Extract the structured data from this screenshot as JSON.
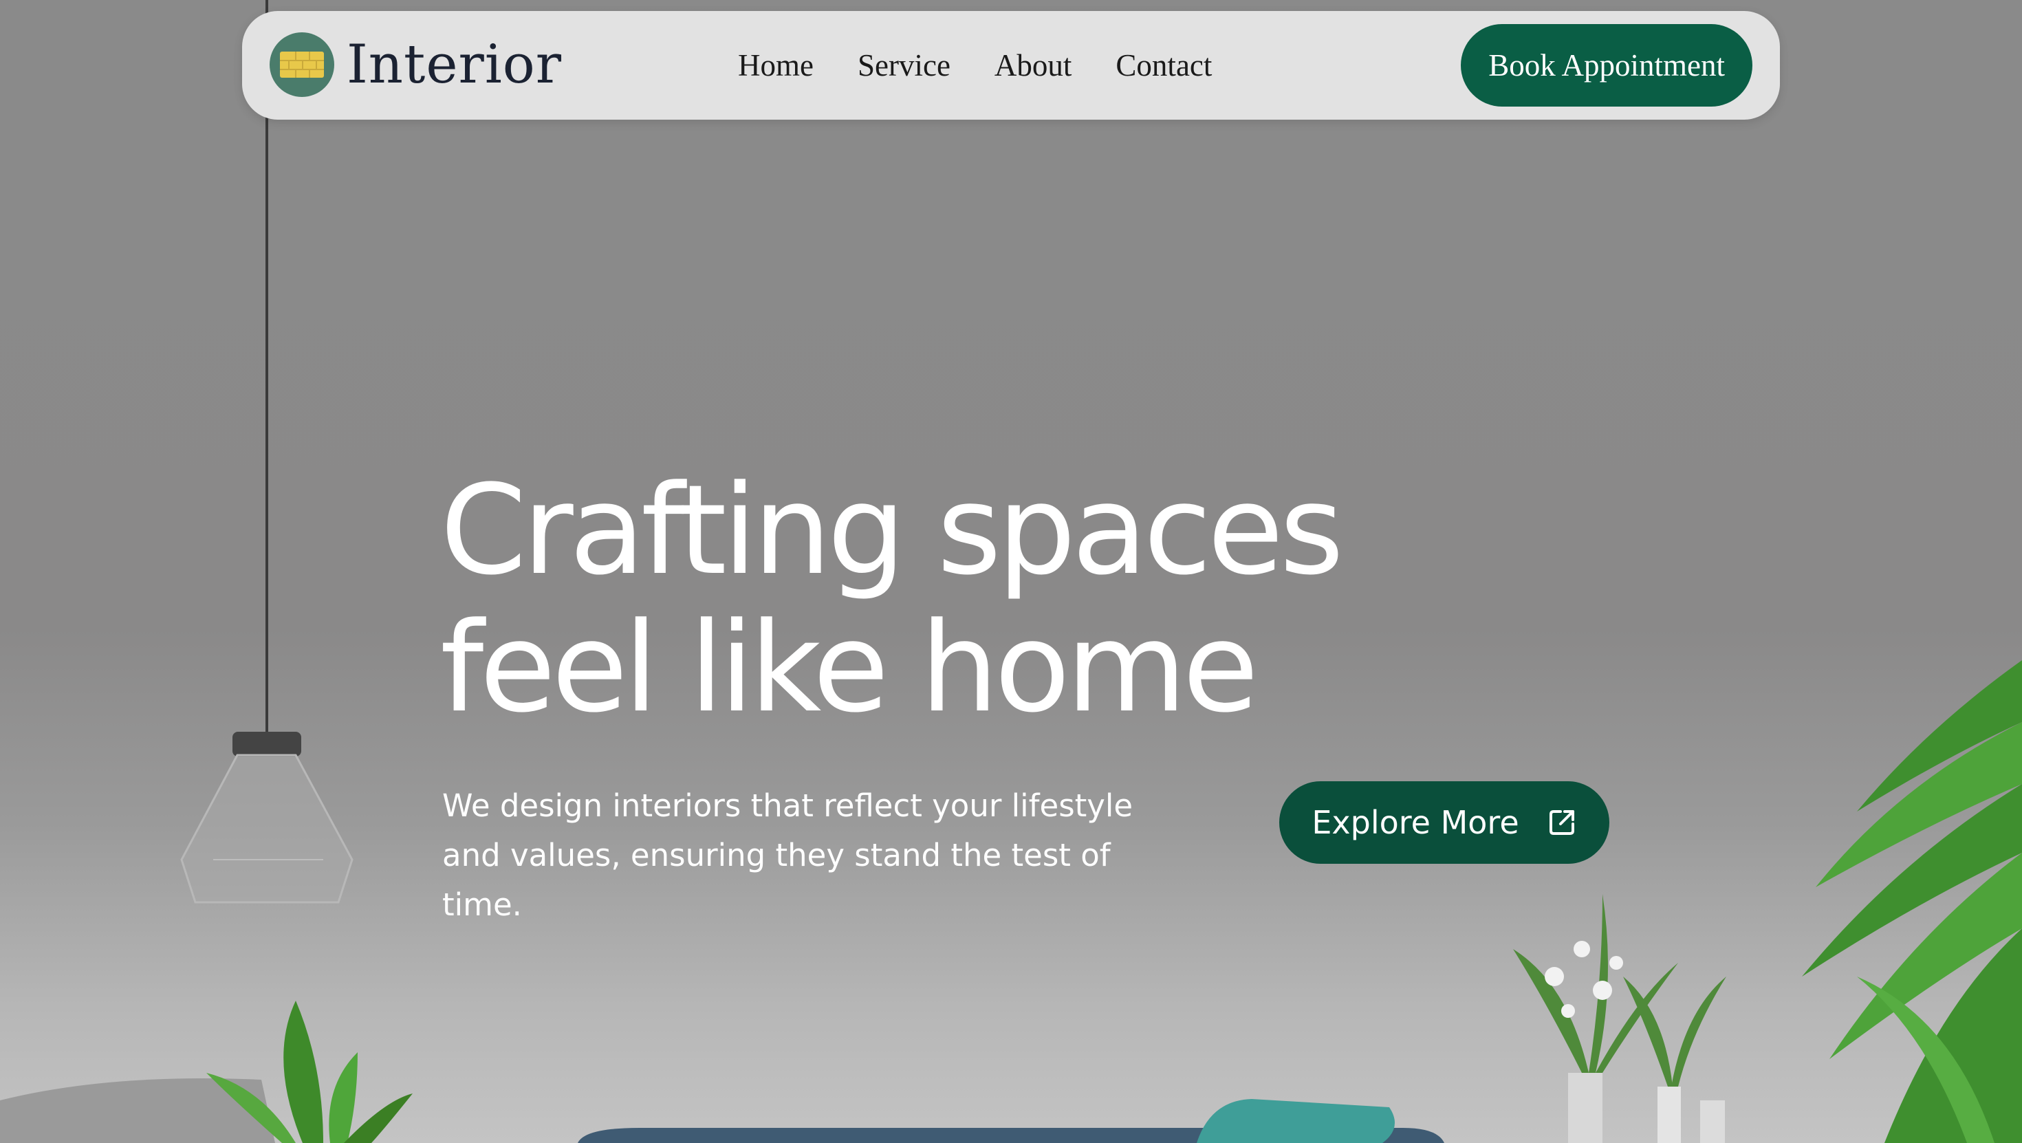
{
  "brand": {
    "name": "Interior",
    "logo_icon": "brick-wall-icon",
    "logo_color": "#4a7c6b",
    "brick_color": "#e8c84a"
  },
  "nav": {
    "items": [
      {
        "label": "Home"
      },
      {
        "label": "Service"
      },
      {
        "label": "About"
      },
      {
        "label": "Contact"
      }
    ],
    "cta_label": "Book Appointment"
  },
  "hero": {
    "headline_line1": "Crafting spaces",
    "headline_line2": "feel like home",
    "description": "We design interiors that reflect your lifestyle and values, ensuring they stand the test of time.",
    "button_label": "Explore More",
    "button_icon": "external-link-icon"
  },
  "colors": {
    "accent": "#0a5e45",
    "button_dark": "#0a4f3b",
    "nav_bg": "#e2e2e2"
  }
}
